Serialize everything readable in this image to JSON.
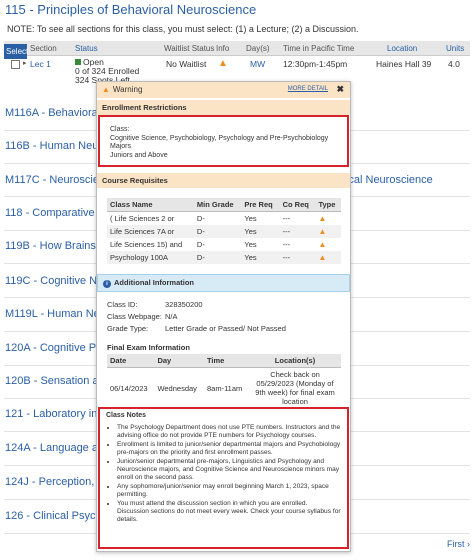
{
  "header": {
    "title": "115 - Principles of Behavioral Neuroscience",
    "note": "NOTE: To see all sections for this class, you must select: (1) a Lecture; (2) a Discussion."
  },
  "table": {
    "columns": [
      "Select",
      "Section",
      "Status",
      "Waitlist Status",
      "Info",
      "Day(s)",
      "Time in Pacific Time",
      "Location",
      "Units"
    ],
    "row": {
      "section": "Lec 1",
      "status_line1": "Open",
      "status_line2": "0 of 324 Enrolled",
      "status_line3": "324 Spots Left",
      "waitlist": "No Waitlist",
      "days": "MW",
      "time": "12:30pm-1:45pm",
      "location": "Haines Hall 39",
      "units": "4.0"
    }
  },
  "courses": [
    "M116A - Behavioral Neuroscience",
    "116B - Human Neuropsychology",
    "M117C - Neuroscience of Psychiatric and Neurological Disorders: Clinical Neuroscience",
    "118 - Comparative Psychobiology",
    "119B - How Brains Learn",
    "119C - Cognitive Neuroscience",
    "M119L - Human Neuroimaging",
    "120A - Cognitive Psychology",
    "120B - Sensation and Perception",
    "121 - Laboratory in Cognitive Psychology",
    "124A - Language as a Cognitive System",
    "124J - Perception, Language, and Cognition",
    "126 - Clinical Psychology"
  ],
  "footer": {
    "first_link": "First"
  },
  "popup": {
    "title": "Warning",
    "more_detail": "MORE DETAIL",
    "close": "✖",
    "enrollment_header": "Enrollment Restrictions",
    "restriction_line1": "Class:",
    "restriction_line2": "Cognitive Science, Psychobiology, Psychology and Pre-Psychobiology Majors",
    "restriction_line3": "Juniors and Above",
    "prereq_header": "Course Requisites",
    "prereq_columns": [
      "Class Name",
      "Min Grade",
      "Pre Req",
      "Co Req",
      "Type"
    ],
    "prereqs": [
      {
        "name": "( Life Sciences 2 or",
        "min": "D-",
        "pre": "Yes",
        "co": "---"
      },
      {
        "name": "Life Sciences 7A or",
        "min": "D-",
        "pre": "Yes",
        "co": "---"
      },
      {
        "name": "Life Sciences 15) and",
        "min": "D-",
        "pre": "Yes",
        "co": "---"
      },
      {
        "name": "Psychology 100A",
        "min": "D-",
        "pre": "Yes",
        "co": "---"
      }
    ],
    "additional_header": "Additional Information",
    "class_id_label": "Class ID:",
    "class_id": "328350200",
    "webpage_label": "Class Webpage:",
    "webpage": "N/A",
    "grade_label": "Grade Type:",
    "grade": "Letter Grade or Passed/ Not Passed",
    "final_exam_title": "Final Exam Information",
    "final_columns": [
      "Date",
      "Day",
      "Time",
      "Location(s)"
    ],
    "final_row": {
      "date": "06/14/2023",
      "day": "Wednesday",
      "time": "8am-11am",
      "location": "Check back on 05/29/2023 (Monday of 9th week) for final exam location"
    },
    "notes_title": "Class Notes",
    "notes": [
      "The Psychology Department does not use PTE numbers. Instructors and the advising office do not provide PTE numbers for Psychology courses.",
      "Enrollment is limited to junior/senior departmental majors and Psychobiology pre-majors on the priority and first enrollment passes.",
      "Junior/senior departmental pre-majors, Linguistics and Psychology and Neuroscience majors, and Cognitive Science and Neuroscience minors may enroll on the second pass.",
      "Any sophomore/junior/senior may enroll beginning March 1, 2023, space permitting.",
      "You must attend the discussion section in which you are enrolled. Discussion sections do not meet every week. Check your course syllabus for details."
    ]
  }
}
